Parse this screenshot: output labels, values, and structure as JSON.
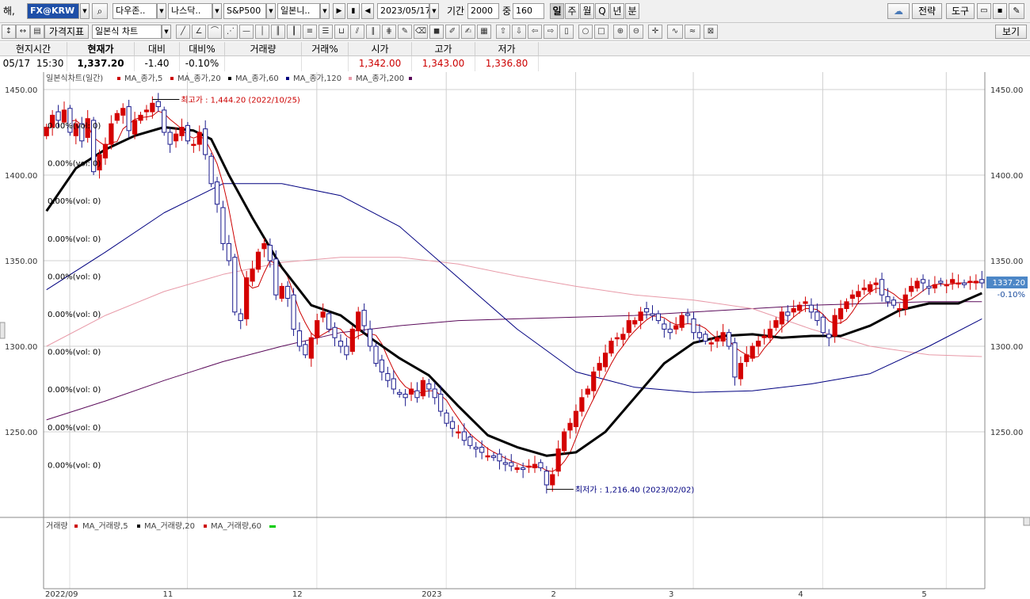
{
  "toolbar1": {
    "prefix": "해,",
    "symbol_value": "FX@KRW",
    "tabs": [
      "다우존..",
      "나스닥..",
      "S&P500",
      "일본니.."
    ],
    "date_value": "2023/05/17",
    "period_label": "기간",
    "period_value": "2000",
    "count_label": "중",
    "count_value": "160",
    "timeframes": [
      "일",
      "주",
      "월",
      "Q",
      "년",
      "분"
    ],
    "strategy_label": "전략",
    "tools_label": "도구"
  },
  "toolbar2": {
    "indicator_label": "가격지표",
    "charttype_value": "일본식 차트",
    "view_label": "보기"
  },
  "quote": {
    "headers": [
      "현지시간",
      "현재가",
      "대비",
      "대비%",
      "거래량",
      "거래%",
      "시가",
      "고가",
      "저가"
    ],
    "date": "05/17",
    "time": "15:30",
    "values": [
      "1,337.20",
      "-1.40",
      "-0.10%",
      "",
      "",
      "1,342.00",
      "1,343.00",
      "1,336.80"
    ]
  },
  "chart_data": {
    "type": "candlestick",
    "legend": [
      "일본식차트(일간)",
      "MA_종가,5",
      "MA_종가,20",
      "MA_종가,60",
      "MA_종가,120",
      "MA_종가,200"
    ],
    "legend_colors": [
      "#cc0000",
      "#cc0000",
      "#000000",
      "#000080",
      "#e89aa8"
    ],
    "ylim": [
      1200,
      1460
    ],
    "y_ticks": [
      1250,
      1300,
      1350,
      1400,
      1450
    ],
    "y_tick_labels": [
      "1250.00",
      "1300.00",
      "1350.00",
      "1400.00",
      "1450.00"
    ],
    "x_ticks": [
      {
        "label": "2022/09",
        "i": 0
      },
      {
        "label": "11",
        "i": 20
      },
      {
        "label": "12",
        "i": 42
      },
      {
        "label": "2023",
        "i": 64
      },
      {
        "label": "2",
        "i": 86
      },
      {
        "label": "3",
        "i": 106
      },
      {
        "label": "4",
        "i": 128
      },
      {
        "label": "5",
        "i": 149
      }
    ],
    "n_bars": 160,
    "bar_closes": [
      1428,
      1435,
      1432,
      1438,
      1425,
      1430,
      1420,
      1433,
      1402,
      1412,
      1418,
      1430,
      1436,
      1439,
      1426,
      1432,
      1435,
      1438,
      1442,
      1440,
      1425,
      1418,
      1424,
      1428,
      1420,
      1418,
      1425,
      1412,
      1395,
      1383,
      1360,
      1350,
      1320,
      1315,
      1340,
      1345,
      1355,
      1360,
      1350,
      1330,
      1335,
      1328,
      1310,
      1300,
      1295,
      1305,
      1315,
      1320,
      1310,
      1305,
      1300,
      1295,
      1310,
      1320,
      1312,
      1300,
      1290,
      1285,
      1280,
      1275,
      1272,
      1270,
      1275,
      1270,
      1280,
      1275,
      1270,
      1262,
      1255,
      1252,
      1250,
      1245,
      1242,
      1240,
      1238,
      1236,
      1235,
      1233,
      1231,
      1230,
      1229,
      1228,
      1230,
      1231,
      1229,
      1219,
      1225,
      1240,
      1250,
      1255,
      1262,
      1270,
      1275,
      1285,
      1290,
      1296,
      1303,
      1305,
      1307,
      1315,
      1315,
      1320,
      1320,
      1318,
      1315,
      1310,
      1308,
      1312,
      1318,
      1318,
      1308,
      1305,
      1303,
      1302,
      1305,
      1308,
      1300,
      1282,
      1290,
      1295,
      1300,
      1303,
      1306,
      1310,
      1315,
      1320,
      1318,
      1322,
      1324,
      1326,
      1320,
      1315,
      1308,
      1305,
      1318,
      1322,
      1326,
      1330,
      1332,
      1334,
      1336,
      1337,
      1330,
      1326,
      1324,
      1322,
      1330,
      1335,
      1338,
      1337,
      1334,
      1336,
      1337,
      1336,
      1339,
      1337,
      1336,
      1338,
      1338,
      1337
    ],
    "ma_series": [
      {
        "name": "MA_종가,5",
        "color": "#cc0000",
        "width": 1
      },
      {
        "name": "MA_종가,20",
        "color": "#000000",
        "width": 3
      },
      {
        "name": "MA_종가,60",
        "color": "#000080",
        "width": 1
      },
      {
        "name": "MA_종가,120",
        "color": "#e89aa8",
        "width": 1
      },
      {
        "name": "MA_종가,200",
        "color": "#5a0a5a",
        "width": 1
      }
    ],
    "ma20_points": [
      [
        0,
        1379
      ],
      [
        5,
        1404
      ],
      [
        10,
        1415
      ],
      [
        15,
        1423
      ],
      [
        20,
        1428
      ],
      [
        25,
        1426
      ],
      [
        28,
        1421
      ],
      [
        31,
        1400
      ],
      [
        35,
        1375
      ],
      [
        40,
        1346
      ],
      [
        45,
        1324
      ],
      [
        50,
        1318
      ],
      [
        55,
        1305
      ],
      [
        60,
        1293
      ],
      [
        65,
        1283
      ],
      [
        70,
        1265
      ],
      [
        75,
        1248
      ],
      [
        80,
        1241
      ],
      [
        85,
        1236
      ],
      [
        90,
        1238
      ],
      [
        95,
        1250
      ],
      [
        100,
        1270
      ],
      [
        105,
        1290
      ],
      [
        110,
        1302
      ],
      [
        115,
        1306
      ],
      [
        120,
        1307
      ],
      [
        125,
        1305
      ],
      [
        130,
        1306
      ],
      [
        135,
        1306
      ],
      [
        140,
        1312
      ],
      [
        145,
        1321
      ],
      [
        150,
        1325
      ],
      [
        155,
        1325
      ],
      [
        159,
        1331
      ]
    ],
    "ma60_points": [
      [
        0,
        1333
      ],
      [
        10,
        1355
      ],
      [
        20,
        1378
      ],
      [
        30,
        1395
      ],
      [
        40,
        1395
      ],
      [
        50,
        1388
      ],
      [
        60,
        1370
      ],
      [
        70,
        1340
      ],
      [
        80,
        1310
      ],
      [
        90,
        1285
      ],
      [
        100,
        1276
      ],
      [
        110,
        1273
      ],
      [
        120,
        1274
      ],
      [
        130,
        1278
      ],
      [
        140,
        1284
      ],
      [
        150,
        1300
      ],
      [
        159,
        1316
      ]
    ],
    "ma120_points": [
      [
        0,
        1300
      ],
      [
        10,
        1318
      ],
      [
        20,
        1332
      ],
      [
        30,
        1342
      ],
      [
        40,
        1349
      ],
      [
        50,
        1352
      ],
      [
        60,
        1352
      ],
      [
        70,
        1348
      ],
      [
        80,
        1341
      ],
      [
        90,
        1335
      ],
      [
        100,
        1330
      ],
      [
        110,
        1327
      ],
      [
        120,
        1322
      ],
      [
        130,
        1310
      ],
      [
        140,
        1300
      ],
      [
        150,
        1295
      ],
      [
        159,
        1294
      ]
    ],
    "ma200_points": [
      [
        0,
        1257
      ],
      [
        10,
        1268
      ],
      [
        20,
        1280
      ],
      [
        30,
        1291
      ],
      [
        40,
        1300
      ],
      [
        50,
        1308
      ],
      [
        60,
        1312
      ],
      [
        70,
        1315
      ],
      [
        80,
        1316
      ],
      [
        90,
        1317
      ],
      [
        100,
        1318
      ],
      [
        110,
        1320
      ],
      [
        120,
        1322
      ],
      [
        130,
        1324
      ],
      [
        140,
        1325
      ],
      [
        150,
        1326
      ],
      [
        159,
        1326
      ]
    ],
    "high": {
      "label": "최고가 : 1,444.20 (2022/10/25)",
      "value": 1444.2,
      "i": 18
    },
    "low": {
      "label": "최저가 : 1,216.40 (2023/02/02)",
      "value": 1216.4,
      "i": 85
    },
    "last_price_label": "1337.20",
    "last_change_label": "-0.10%",
    "vol_labels": [
      "0.00%(vol: 0)",
      "0.00%(vol: 0)",
      "0.00%(vol: 0)",
      "0.00%(vol: 0)",
      "0.00%(vol: 0)",
      "0.00%(vol: 0)",
      "0.00%(vol: 0)",
      "0.00%(vol: 0)",
      "0.00%(vol: 0)",
      "0.00%(vol: 0)"
    ],
    "volume_panel": {
      "legend": [
        "거래량",
        "MA_거래량,5",
        "MA_거래량,20",
        "MA_거래량,60"
      ],
      "legend_colors": [
        "#cc0000",
        "#000000",
        "#cc0000",
        "#00cc00"
      ]
    }
  }
}
